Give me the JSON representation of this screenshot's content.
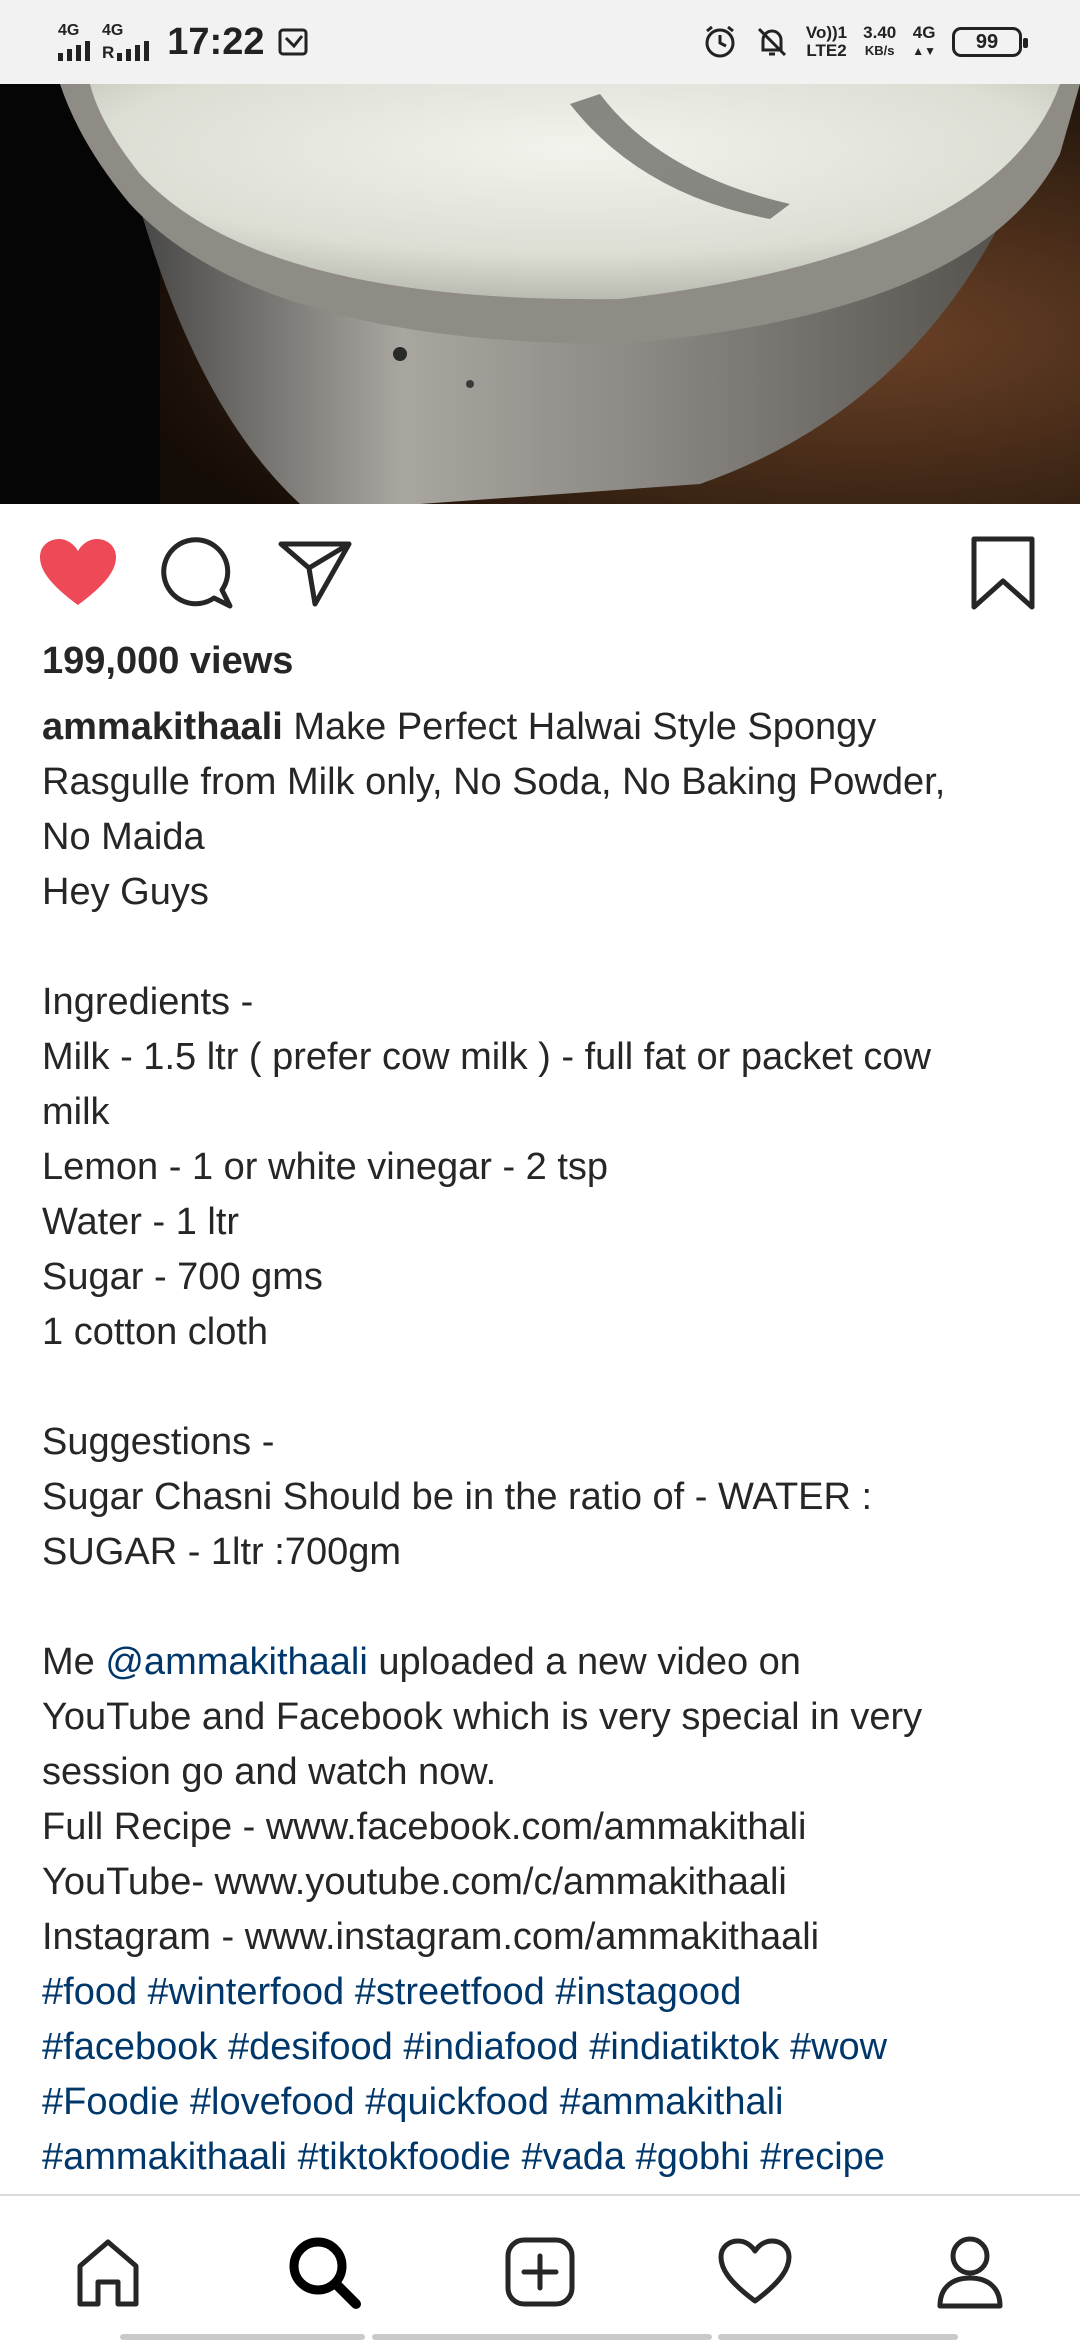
{
  "status_bar": {
    "net1": "4G",
    "net2": "4G",
    "net2_sub": "R",
    "time": "17:22",
    "volte": "Vo))1",
    "lte": "LTE2",
    "speed_value": "3.40",
    "speed_unit": "KB/s",
    "net3": "4G",
    "battery": "99"
  },
  "post": {
    "views": "199,000 views",
    "username": "ammakithaali",
    "caption_first": " Make Perfect Halwai Style Spongy",
    "caption_lines": [
      "Rasgulle from Milk only, No Soda, No Baking Powder,",
      "No Maida",
      "Hey Guys"
    ],
    "ingredients_header": "Ingredients -",
    "ingredients": [
      "Milk - 1.5 ltr ( prefer cow milk ) - full fat or packet cow",
      "milk",
      "Lemon - 1 or white vinegar - 2 tsp",
      "Water - 1 ltr",
      "Sugar - 700 gms",
      "1 cotton cloth"
    ],
    "suggestions_header": "Suggestions -",
    "suggestions": [
      "Sugar Chasni Should be in the ratio of - WATER :",
      "SUGAR - 1ltr :700gm"
    ],
    "promo_prefix": "Me ",
    "promo_mention": "@ammakithaali",
    "promo_suffix": " uploaded a new video on",
    "promo_lines": [
      "YouTube and Facebook which is very special in very",
      "session go and watch now.",
      "Full Recipe - www.facebook.com/ammakithali",
      "YouTube- www.youtube.com/c/ammakithaali",
      "Instagram - www.instagram.com/ammakithaali"
    ],
    "hashtag_lines": [
      [
        "#food",
        "#winterfood",
        "#streetfood",
        "#instagood"
      ],
      [
        "#facebook",
        "#desifood",
        "#indiafood",
        "#indiatiktok",
        "#wow"
      ],
      [
        "#Foodie",
        "#lovefood",
        "#quickfood",
        "#ammakithali"
      ],
      [
        "#ammakithaali",
        "#tiktokfoodie",
        "#vada",
        "#gobhi",
        "#recipe"
      ]
    ]
  },
  "actions": {
    "like": "heart-icon",
    "comment": "comment-icon",
    "share": "send-icon",
    "save": "bookmark-icon",
    "like_color": "#ed4956"
  },
  "nav": {
    "items": [
      "home-icon",
      "search-icon",
      "add-post-icon",
      "activity-heart-icon",
      "profile-icon"
    ]
  }
}
